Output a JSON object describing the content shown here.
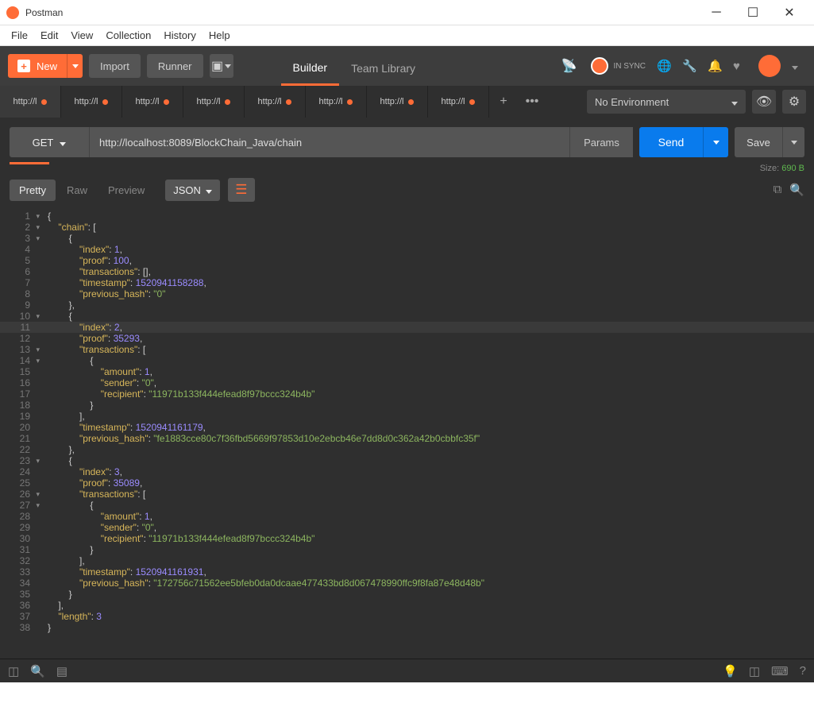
{
  "window": {
    "title": "Postman"
  },
  "menu": {
    "items": [
      "File",
      "Edit",
      "View",
      "Collection",
      "History",
      "Help"
    ]
  },
  "toolbar": {
    "new_label": "New",
    "import_label": "Import",
    "runner_label": "Runner",
    "nav_tabs": [
      "Builder",
      "Team Library"
    ],
    "sync_label": "IN SYNC"
  },
  "tabs": {
    "items": [
      {
        "label": "http://l",
        "dirty": true,
        "active": true
      },
      {
        "label": "http://l",
        "dirty": true
      },
      {
        "label": "http://l",
        "dirty": true
      },
      {
        "label": "http://l",
        "dirty": true
      },
      {
        "label": "http://l",
        "dirty": true
      },
      {
        "label": "http://l",
        "dirty": true
      },
      {
        "label": "http://l",
        "dirty": true
      },
      {
        "label": "http://l",
        "dirty": true
      }
    ],
    "env_label": "No Environment"
  },
  "request": {
    "method": "GET",
    "url": "http://localhost:8089/BlockChain_Java/chain",
    "params_label": "Params",
    "send_label": "Send",
    "save_label": "Save",
    "size_label": "Size:",
    "size_value": "690 B"
  },
  "response_tabs": {
    "items": [
      "Pretty",
      "Raw",
      "Preview"
    ],
    "format": "JSON"
  },
  "response_json": {
    "chain": [
      {
        "index": 1,
        "proof": 100,
        "transactions": [],
        "timestamp": 1520941158288,
        "previous_hash": "0"
      },
      {
        "index": 2,
        "proof": 35293,
        "transactions": [
          {
            "amount": 1,
            "sender": "0",
            "recipient": "11971b133f444efead8f97bccc324b4b"
          }
        ],
        "timestamp": 1520941161179,
        "previous_hash": "fe1883cce80c7f36fbd5669f97853d10e2ebcb46e7dd8d0c362a42b0cbbfc35f"
      },
      {
        "index": 3,
        "proof": 35089,
        "transactions": [
          {
            "amount": 1,
            "sender": "0",
            "recipient": "11971b133f444efead8f97bccc324b4b"
          }
        ],
        "timestamp": 1520941161931,
        "previous_hash": "172756c71562ee5bfeb0da0dcaae477433bd8d067478990ffc9f8fa87e48d48b"
      }
    ],
    "length": 3
  },
  "highlight_line": 11
}
